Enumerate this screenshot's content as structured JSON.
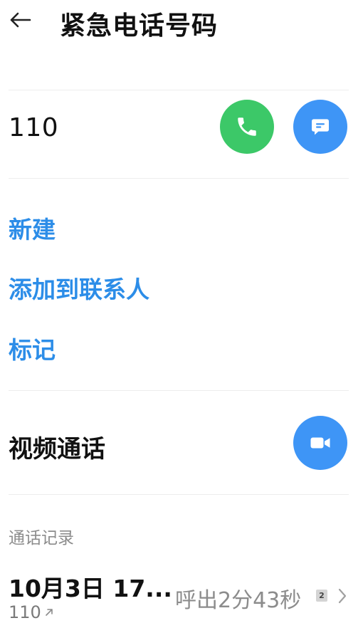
{
  "header": {
    "back_icon": "arrow-left-icon",
    "title": "紧急电话号码"
  },
  "contact": {
    "number": "110",
    "call_icon": "phone-icon",
    "message_icon": "message-icon",
    "call_color": "#3cc868",
    "message_color": "#3e95f6"
  },
  "actions": {
    "new": "新建",
    "add_to_contacts": "添加到联系人",
    "mark": "标记"
  },
  "video_call": {
    "label": "视频通话",
    "icon": "video-camera-icon"
  },
  "call_log": {
    "section_title": "通话记录",
    "entries": [
      {
        "date": "10月3日 17...",
        "number": "110",
        "direction_icon": "outgoing-arrow-icon",
        "status": "呼出2分43秒",
        "sim": "2"
      }
    ]
  },
  "accent_color": "#2c8de8"
}
